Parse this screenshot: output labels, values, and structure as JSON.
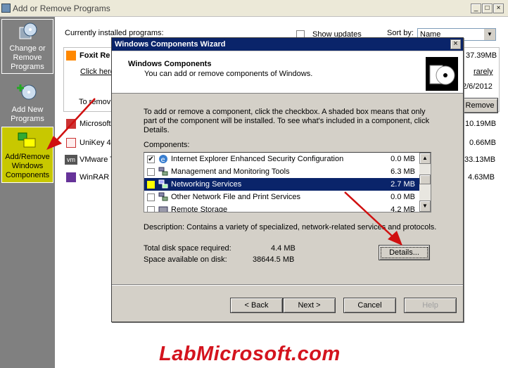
{
  "window": {
    "title": "Add or Remove Programs",
    "min": "_",
    "max": "□",
    "close": "×"
  },
  "sidebar": {
    "change_remove": "Change or Remove Programs",
    "add_new": "Add New Programs",
    "add_remove_components": "Add/Remove Windows Components"
  },
  "content": {
    "currently_installed": "Currently installed programs:",
    "show_updates": "Show updates",
    "sort_by": "Sort by:",
    "sort_value": "Name",
    "programs": [
      {
        "name": "Foxit Re",
        "size": "37.39MB"
      },
      {
        "name": "Microsoft",
        "size": "10.19MB"
      },
      {
        "name": "UniKey 4.",
        "size": "0.66MB"
      },
      {
        "name": "VMware T",
        "size": "33.13MB"
      },
      {
        "name": "WinRAR a",
        "size": "4.63MB"
      }
    ],
    "click_here": "Click here",
    "rarely": "rarely",
    "date": "2/6/2012",
    "to_remove": "To remov",
    "remove_btn": "Remove"
  },
  "dialog": {
    "title": "Windows Components Wizard",
    "close": "×",
    "header_title": "Windows Components",
    "header_sub": "You can add or remove components of Windows.",
    "intro": "To add or remove a component, click the checkbox.  A shaded box means that only part of the component will be installed.  To see what's included in a component, click Details.",
    "components_label": "Components:",
    "components": [
      {
        "name": "Internet Explorer Enhanced Security Configuration",
        "size": "0.0 MB",
        "checked": "✔"
      },
      {
        "name": "Management and Monitoring Tools",
        "size": "6.3 MB",
        "checked": ""
      },
      {
        "name": "Networking Services",
        "size": "2.7 MB",
        "checked": ""
      },
      {
        "name": "Other Network File and Print Services",
        "size": "0.0 MB",
        "checked": ""
      },
      {
        "name": "Remote Storage",
        "size": "4.2 MB",
        "checked": ""
      }
    ],
    "description": "Description:   Contains a variety of specialized, network-related services and protocols.",
    "total_disk_label": "Total disk space required:",
    "total_disk_value": "4.4 MB",
    "space_avail_label": "Space available on disk:",
    "space_avail_value": "38644.5 MB",
    "details_btn": "Details...",
    "back_btn": "< Back",
    "next_btn": "Next >",
    "cancel_btn": "Cancel",
    "help_btn": "Help"
  },
  "watermark": "LabMicrosoft.com",
  "colors": {
    "selection": "#0a246a",
    "highlight_button": "#c8c800",
    "arrow": "#d01010",
    "watermark": "#d4141e"
  }
}
